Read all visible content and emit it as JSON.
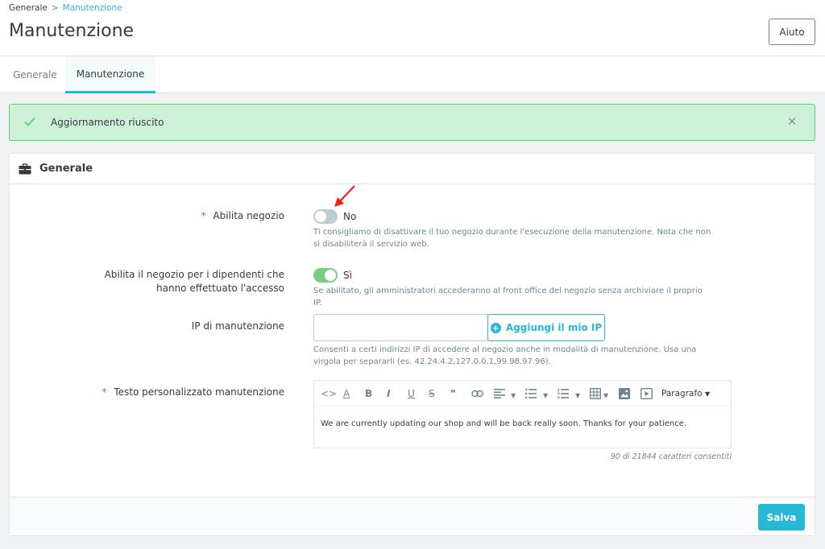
{
  "breadcrumb": {
    "parent": "Generale",
    "separator": ">",
    "current": "Manutenzione"
  },
  "page_title": "Manutenzione",
  "help_button": "Aiuto",
  "tabs": [
    {
      "label": "Generale",
      "active": false
    },
    {
      "label": "Manutenzione",
      "active": true
    }
  ],
  "alert": {
    "text": "Aggiornamento riuscito",
    "close": "×"
  },
  "panel": {
    "title": "Generale",
    "fields": {
      "enable_shop": {
        "label": "Abilita negozio",
        "required": "*",
        "value": false,
        "value_label": "No",
        "help": "Ti consigliamo di disattivare il tuo negozio durante l'esecuzione della manutenzione. Nota che non si disabiliterà il servizio web."
      },
      "enable_shop_logged": {
        "label_line1": "Abilita il negozio per i dipendenti che",
        "label_line2": "hanno effettuato l'accesso",
        "value": true,
        "value_label": "Sì",
        "help": "Se abilitato, gli amministratori accederanno al front office del negozio senza archiviare il proprio IP."
      },
      "maintenance_ip": {
        "label": "IP di manutenzione",
        "value": "",
        "button": "Aggiungi il mio IP",
        "help": "Consenti a certi indirizzi IP di accedere al negozio anche in modalità di manutenzione. Usa una virgola per separarli (es. 42.24.4.2,127.0.0.1,99.98.97.96)."
      },
      "maintenance_text": {
        "label": "Testo personalizzato manutenzione",
        "required": "*",
        "toolbar": {
          "code": "<>",
          "bold": "B",
          "italic": "I",
          "underline": "U",
          "strike": "S",
          "quote": "❞",
          "paragraph": "Paragrafo"
        },
        "content": "We are currently updating our shop and will be back really soon. Thanks for your patience.",
        "counter": "90 di 21844 caratteri consentiti"
      }
    },
    "save_button": "Salva"
  },
  "colors": {
    "accent": "#25b9d7",
    "success_bg": "#cdf0d8",
    "success_border": "#53d572",
    "toggle_on": "#78d07d",
    "toggle_off": "#bbcdd2",
    "required": "#f54c3e",
    "annotation_arrow": "#e8231c"
  }
}
